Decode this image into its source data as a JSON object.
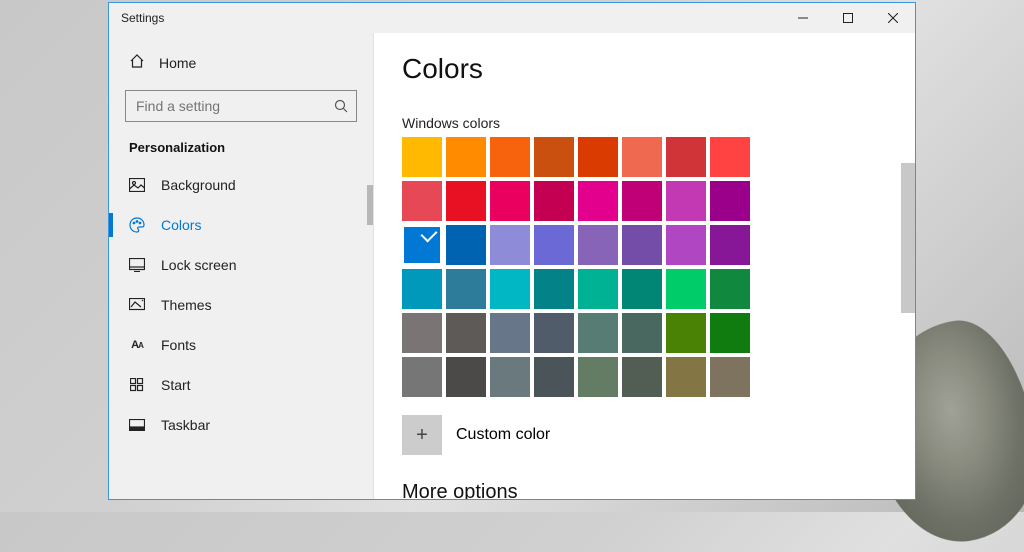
{
  "window": {
    "title": "Settings"
  },
  "sidebar": {
    "home_label": "Home",
    "search_placeholder": "Find a setting",
    "section": "Personalization",
    "items": [
      {
        "label": "Background",
        "icon": "image-icon"
      },
      {
        "label": "Colors",
        "icon": "palette-icon",
        "selected": true
      },
      {
        "label": "Lock screen",
        "icon": "lockscreen-icon"
      },
      {
        "label": "Themes",
        "icon": "themes-icon"
      },
      {
        "label": "Fonts",
        "icon": "fonts-icon"
      },
      {
        "label": "Start",
        "icon": "start-icon"
      },
      {
        "label": "Taskbar",
        "icon": "taskbar-icon"
      }
    ]
  },
  "content": {
    "heading": "Colors",
    "grid_label": "Windows colors",
    "selected_index": 16,
    "colors": [
      "#ffb900",
      "#ff8c00",
      "#f7630c",
      "#ca5010",
      "#da3b01",
      "#ef6950",
      "#d13438",
      "#ff4343",
      "#e74856",
      "#e81123",
      "#ea005e",
      "#c30052",
      "#e3008c",
      "#bf0077",
      "#c239b3",
      "#9a0089",
      "#0078d4",
      "#0063b1",
      "#8e8cd8",
      "#6b69d6",
      "#8764b8",
      "#744da9",
      "#b146c2",
      "#881798",
      "#0099bc",
      "#2d7d9a",
      "#00b7c3",
      "#038387",
      "#00b294",
      "#018574",
      "#00cc6a",
      "#10893e",
      "#7a7574",
      "#5d5a58",
      "#68768a",
      "#515c6b",
      "#567c73",
      "#486860",
      "#498205",
      "#107c10",
      "#767676",
      "#4c4a48",
      "#69797e",
      "#4a5459",
      "#647c64",
      "#525e54",
      "#847545",
      "#7e735f"
    ],
    "custom_label": "Custom color",
    "more_heading": "More options"
  }
}
